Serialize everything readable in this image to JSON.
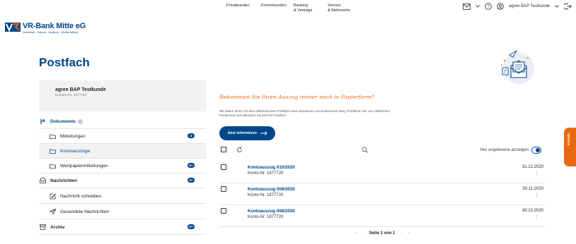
{
  "topnav": {
    "items": [
      {
        "label": "Privatkunden"
      },
      {
        "label": "Firmenkunden"
      },
      {
        "label": "Banking\n& Verträge"
      },
      {
        "label": "Service\n& Mehrwerte"
      }
    ],
    "user_label": "agree BAP Testkunde",
    "icons": [
      "mail-icon",
      "help-icon",
      "user-icon",
      "logout-icon"
    ]
  },
  "brand": {
    "name": "VR-Bank Mitte eG",
    "tagline": "Duderstadt · Geismar · Nordhorn · Worbis Heilbad",
    "color": "#00468b",
    "accent": "#e86a10"
  },
  "page_title": "Postfach",
  "user_card": {
    "name": "agree BAP Testkunde",
    "customer_nr": "Kunden-Nr. 1877720"
  },
  "sidebar": {
    "dokumente": "Dokumente",
    "items": [
      {
        "label": "Mitteilungen",
        "badge": "4"
      },
      {
        "label": "Kontoauszüge",
        "badge": ""
      },
      {
        "label": "Wertpapiermitteilungen",
        "badge": "5+"
      }
    ],
    "nachrichten": {
      "label": "Nachrichten",
      "badge": "5+"
    },
    "nachricht_schreiben": "Nachricht schreiben",
    "gesendete": "Gesendete Nachrichten",
    "archiv": {
      "label": "Archiv",
      "badge": "5+"
    }
  },
  "promo": {
    "title": "Bekommen Sie Ihren Auszug immer noch in Papierform?",
    "text": "Wir bieten Ihnen mit dem elektronischen Postfach einen bequemen und einfacheren Weg. Profitieren Sie von zahlreichen Funktionen und aktivieren Sie jetzt Ihr Postfach.",
    "button": "Jetzt informieren"
  },
  "toolbar": {
    "only_unread": "Nur ungelesene anzeigen"
  },
  "messages": [
    {
      "title": "Kontoauszug 010/2020",
      "konto": "Konto-Nr. 1877720",
      "date": "31.12.2020"
    },
    {
      "title": "Kontoauszug 009/2020",
      "konto": "Konto-Nr. 1877720",
      "date": "30.11.2020"
    },
    {
      "title": "Kontoauszug 008/2020",
      "konto": "Konto-Nr. 1877720",
      "date": "30.10.2020"
    }
  ],
  "pager": {
    "label": "Seite 1 von 1"
  },
  "kontakt": "Kontakt"
}
